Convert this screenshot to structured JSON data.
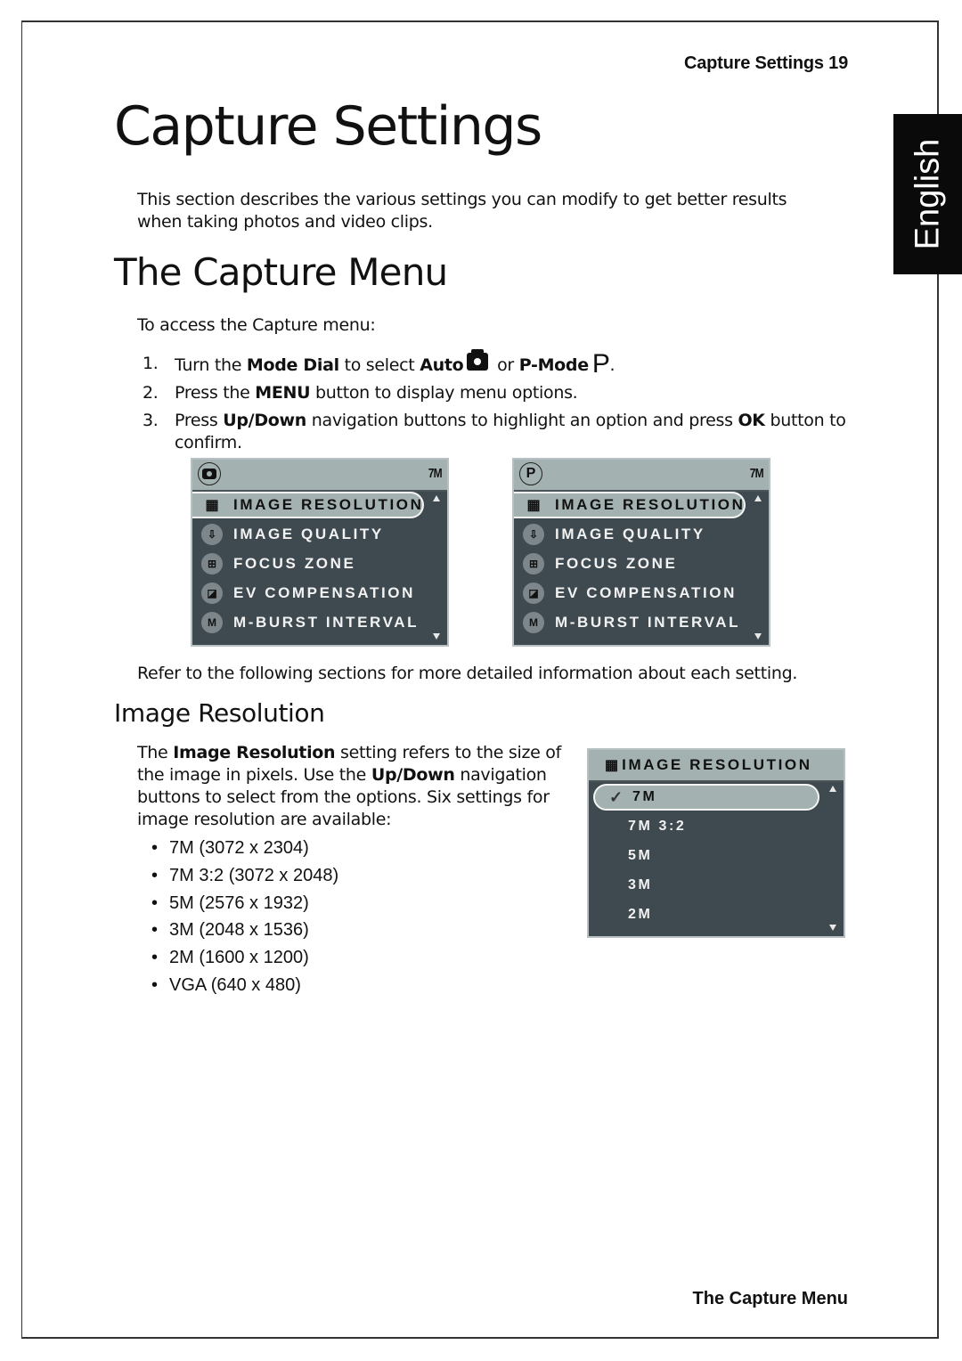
{
  "header": {
    "running_head": "Capture Settings  19"
  },
  "footer": {
    "running_foot": "The Capture Menu"
  },
  "side_tab": {
    "label": "English"
  },
  "title": "Capture Settings",
  "intro": "This section describes the various settings you can modify to get better results when taking photos and video clips.",
  "capture_menu": {
    "heading": "The Capture Menu",
    "access_text": "To access the Capture menu:",
    "steps": [
      {
        "num": "1.",
        "parts": [
          "Turn the ",
          "Mode Dial",
          " to select ",
          "Auto",
          " or ",
          "P-Mode",
          "."
        ]
      },
      {
        "num": "2.",
        "parts": [
          "Press the ",
          "MENU",
          " button to display menu options."
        ]
      },
      {
        "num": "3.",
        "parts": [
          "Press ",
          "Up/Down",
          " navigation buttons to highlight an option and press ",
          "OK",
          " button to confirm."
        ]
      }
    ],
    "screens": [
      {
        "mode_icon": "camera-icon",
        "mode_label": "",
        "size_badge": "7M",
        "items": [
          {
            "icon": "grid-icon",
            "glyph": "▦",
            "label": "IMAGE RESOLUTION",
            "selected": true
          },
          {
            "icon": "quality-icon",
            "glyph": "⇩",
            "label": "IMAGE QUALITY",
            "selected": false
          },
          {
            "icon": "focus-icon",
            "glyph": "⊞",
            "label": "FOCUS ZONE",
            "selected": false
          },
          {
            "icon": "ev-icon",
            "glyph": "◪",
            "label": "EV COMPENSATION",
            "selected": false
          },
          {
            "icon": "burst-icon",
            "glyph": "M",
            "label": "M-BURST INTERVAL",
            "selected": false
          }
        ]
      },
      {
        "mode_icon": "p-mode-icon",
        "mode_label": "P",
        "size_badge": "7M",
        "items": [
          {
            "icon": "grid-icon",
            "glyph": "▦",
            "label": "IMAGE RESOLUTION",
            "selected": true
          },
          {
            "icon": "quality-icon",
            "glyph": "⇩",
            "label": "IMAGE QUALITY",
            "selected": false
          },
          {
            "icon": "focus-icon",
            "glyph": "⊞",
            "label": "FOCUS ZONE",
            "selected": false
          },
          {
            "icon": "ev-icon",
            "glyph": "◪",
            "label": "EV COMPENSATION",
            "selected": false
          },
          {
            "icon": "burst-icon",
            "glyph": "M",
            "label": "M-BURST INTERVAL",
            "selected": false
          }
        ]
      }
    ],
    "refer_text": "Refer to the following sections for more detailed information about each setting."
  },
  "image_resolution": {
    "heading": "Image Resolution",
    "desc_parts": [
      "The ",
      "Image Resolution",
      " setting refers to the size of the image in pixels. Use the ",
      "Up/Down",
      " navigation buttons to select from the options. Six settings for image resolution are available:"
    ],
    "options": [
      "7M (3072 x 2304)",
      "7M 3:2 (3072 x 2048)",
      "5M (2576 x 1932)",
      "3M (2048 x 1536)",
      "2M (1600 x 1200)",
      "VGA (640 x 480)"
    ],
    "screen": {
      "title_glyph": "▦",
      "title": "IMAGE RESOLUTION",
      "check_glyph": "✓",
      "items": [
        {
          "label": "7M",
          "selected": true
        },
        {
          "label": "7M 3:2",
          "selected": false
        },
        {
          "label": "5M",
          "selected": false
        },
        {
          "label": "3M",
          "selected": false
        },
        {
          "label": "2M",
          "selected": false
        }
      ]
    }
  },
  "colors": {
    "lcd_bg": "#3f4a50",
    "lcd_highlight": "#a3b1b1",
    "side_tab_bg": "#0a0a0a"
  }
}
